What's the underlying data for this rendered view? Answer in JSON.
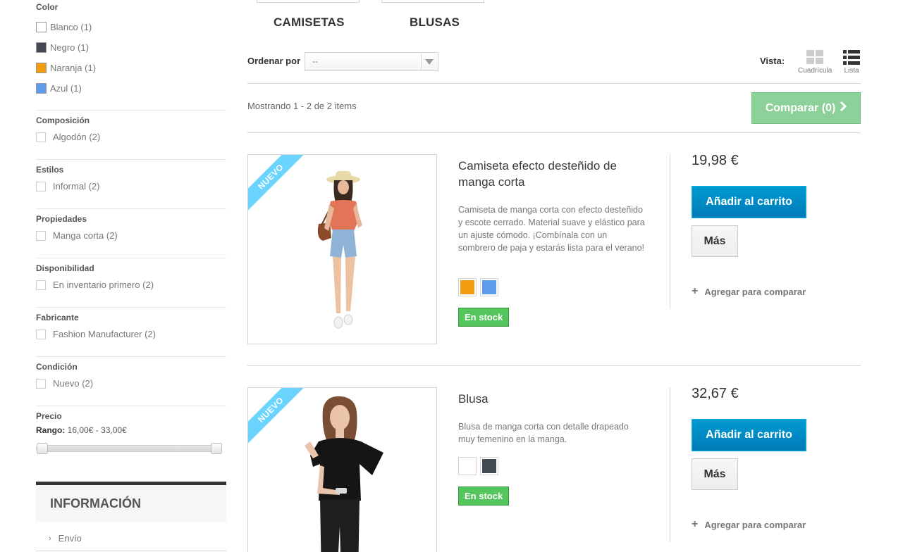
{
  "sidebar": {
    "color_title": "Color",
    "colors": [
      {
        "label": "Blanco (1)",
        "hex": "#ffffff"
      },
      {
        "label": "Negro (1)",
        "hex": "#434a54"
      },
      {
        "label": "Naranja (1)",
        "hex": "#f39c11"
      },
      {
        "label": "Azul (1)",
        "hex": "#5d9cec"
      }
    ],
    "filters": [
      {
        "title": "Composición",
        "option": "Algodón (2)"
      },
      {
        "title": "Estilos",
        "option": "Informal (2)"
      },
      {
        "title": "Propiedades",
        "option": "Manga corta (2)"
      },
      {
        "title": "Disponibilidad",
        "option": "En inventario primero (2)"
      },
      {
        "title": "Fabricante",
        "option": "Fashion Manufacturer (2)"
      },
      {
        "title": "Condición",
        "option": "Nuevo (2)"
      }
    ],
    "price": {
      "title": "Precio",
      "range_label": "Rango:",
      "range_value": "16,00€ - 33,00€",
      "min_fraction": 0.0,
      "max_fraction": 1.0
    },
    "info": {
      "title": "Información",
      "items": [
        "Envío"
      ]
    }
  },
  "subcategories": [
    "CAMISETAS",
    "BLUSAS"
  ],
  "sort": {
    "label": "Ordenar por",
    "value": "--"
  },
  "view": {
    "label": "Vista:",
    "grid_label": "Cuadrícula",
    "list_label": "Lista",
    "active": "list"
  },
  "showing": "Mostrando 1 - 2 de 2 items",
  "compare_button": "Comparar (0)",
  "products": [
    {
      "badge": "NUEVO",
      "name": "Camiseta efecto desteñido de manga corta",
      "description": "Camiseta de manga corta con efecto desteñido y escote cerrado. Material suave y elástico para un ajuste cómodo. ¡Combínala con un sombrero de paja y estarás lista para el verano!",
      "colors": [
        "#f39c11",
        "#5d9cec"
      ],
      "stock": "En stock",
      "price": "19,98 €",
      "cart_label": "Añadir al carrito",
      "more_label": "Más",
      "compare_label": "Agregar para comparar"
    },
    {
      "badge": "NUEVO",
      "name": "Blusa",
      "description": "Blusa de manga corta con detalle drapeado muy femenino en la manga.",
      "colors": [
        "#ffffff",
        "#434a54"
      ],
      "stock": "En stock",
      "price": "32,67 €",
      "cart_label": "Añadir al carrito",
      "more_label": "Más",
      "compare_label": "Agregar para comparar"
    }
  ],
  "theme": {
    "accent_blue": "#0083c4",
    "stock_green": "#55c65e",
    "compare_green": "#8cd199",
    "ribbon_blue": "#6ad4ff"
  }
}
